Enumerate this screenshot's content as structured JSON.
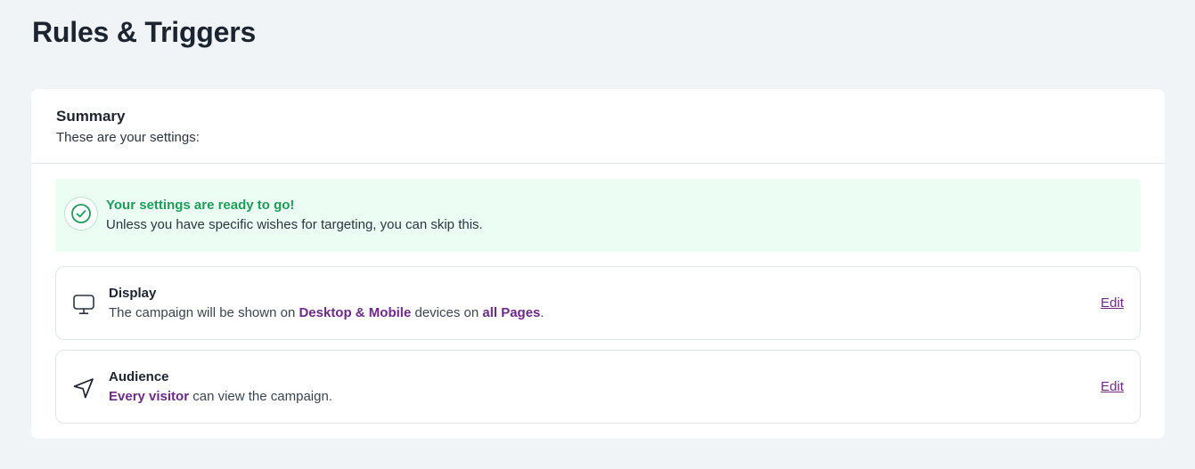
{
  "page": {
    "title": "Rules & Triggers"
  },
  "summary": {
    "title": "Summary",
    "subtitle": "These are your settings:"
  },
  "banner": {
    "icon": "check-circle-icon",
    "title": "Your settings are ready to go!",
    "text": "Unless you have specific wishes for targeting, you can skip this.",
    "color": "#1e9d5a",
    "background": "#ecfdf3"
  },
  "display": {
    "icon": "monitor-icon",
    "title": "Display",
    "desc_prefix": "The campaign will be shown on ",
    "devices": "Desktop & Mobile",
    "desc_middle": " devices on ",
    "pages": "all Pages",
    "desc_suffix": ".",
    "edit_label": "Edit"
  },
  "audience": {
    "icon": "send-icon",
    "title": "Audience",
    "visitors": "Every visitor",
    "desc_suffix": " can view the campaign.",
    "edit_label": "Edit"
  },
  "colors": {
    "background": "#f0f4f7",
    "accent": "#6b2b86",
    "success": "#1e9d5a"
  }
}
